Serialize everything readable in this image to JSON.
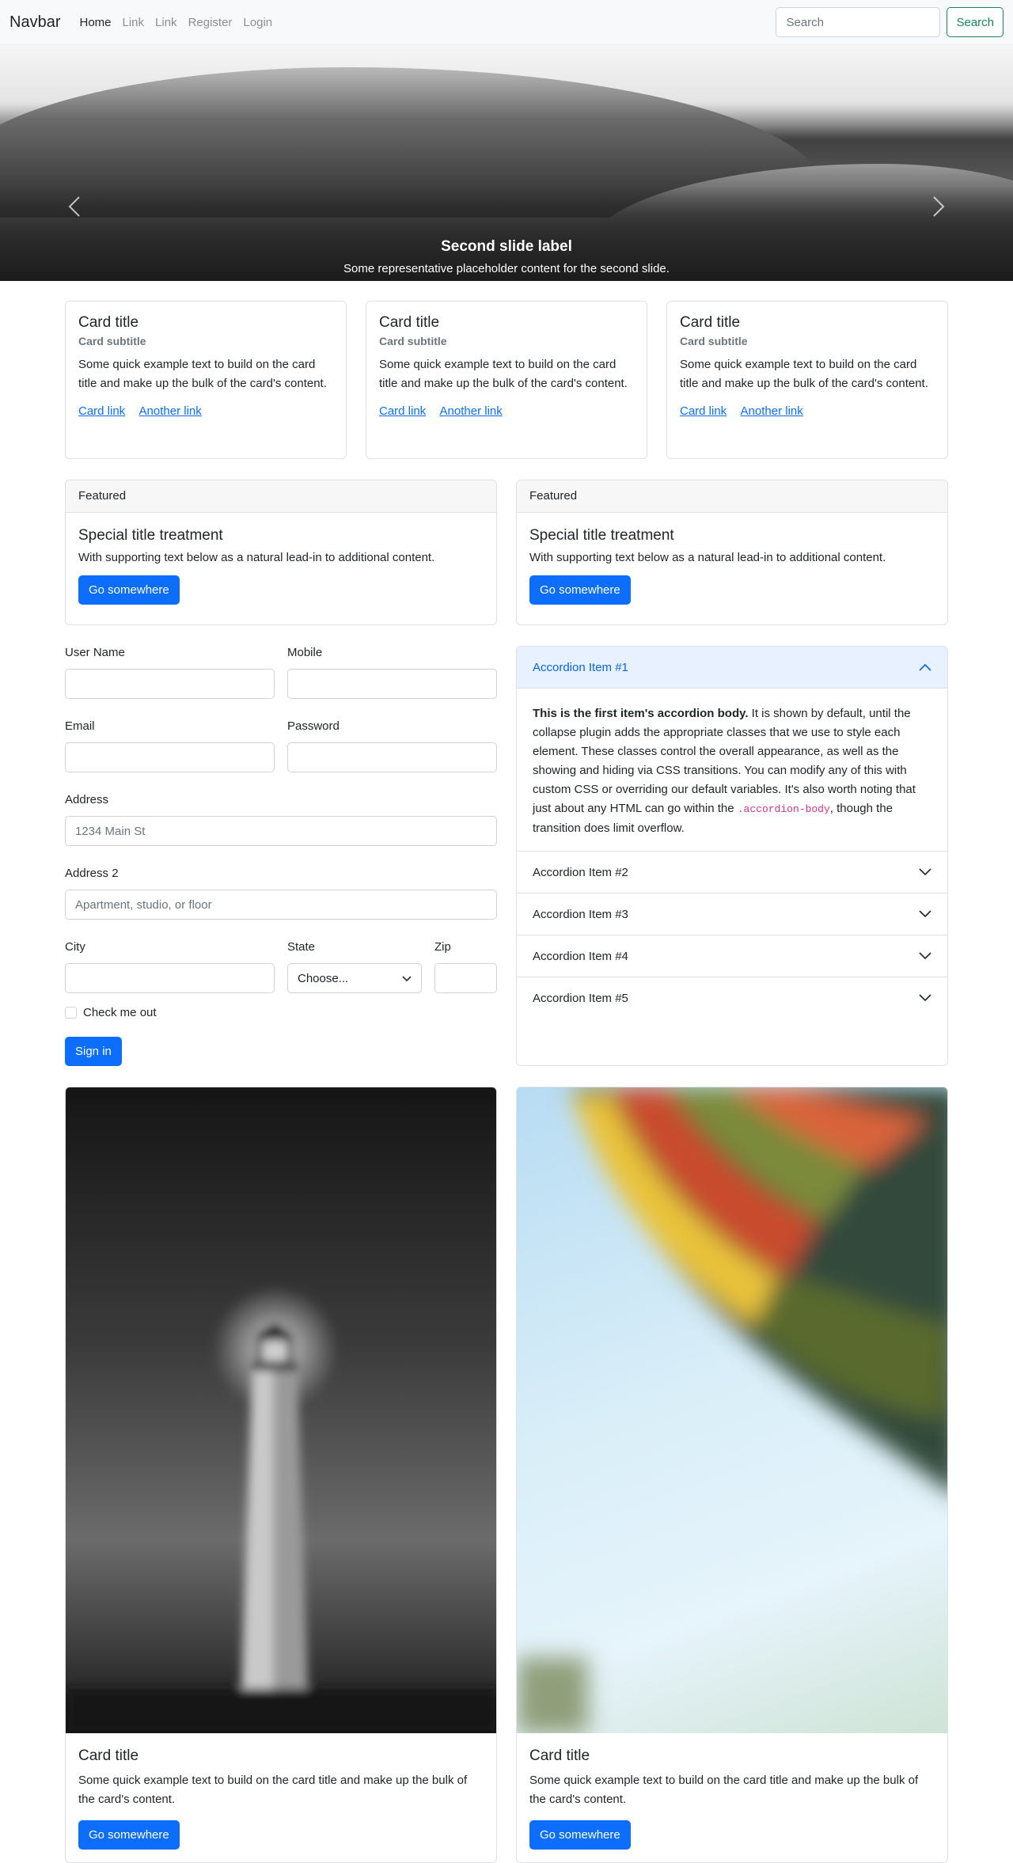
{
  "navbar": {
    "brand": "Navbar",
    "links": [
      "Home",
      "Link",
      "Link",
      "Register",
      "Login"
    ],
    "search_placeholder": "Search",
    "search_button": "Search"
  },
  "carousel": {
    "label": "Second slide label",
    "text": "Some representative placeholder content for the second slide.",
    "indicator_count": 3,
    "active_index": 1
  },
  "cards": [
    {
      "title": "Card title",
      "subtitle": "Card subtitle",
      "text": "Some quick example text to build on the card title and make up the bulk of the card's content.",
      "link1": "Card link",
      "link2": "Another link"
    },
    {
      "title": "Card title",
      "subtitle": "Card subtitle",
      "text": "Some quick example text to build on the card title and make up the bulk of the card's content.",
      "link1": "Card link",
      "link2": "Another link"
    },
    {
      "title": "Card title",
      "subtitle": "Card subtitle",
      "text": "Some quick example text to build on the card title and make up the bulk of the card's content.",
      "link1": "Card link",
      "link2": "Another link"
    }
  ],
  "featured": [
    {
      "header": "Featured",
      "title": "Special title treatment",
      "text": "With supporting text below as a natural lead-in to additional content.",
      "button": "Go somewhere"
    },
    {
      "header": "Featured",
      "title": "Special title treatment",
      "text": "With supporting text below as a natural lead-in to additional content.",
      "button": "Go somewhere"
    }
  ],
  "form": {
    "username_label": "User Name",
    "mobile_label": "Mobile",
    "email_label": "Email",
    "password_label": "Password",
    "address_label": "Address",
    "address_placeholder": "1234 Main St",
    "address2_label": "Address 2",
    "address2_placeholder": "Apartment, studio, or floor",
    "city_label": "City",
    "state_label": "State",
    "state_value": "Choose...",
    "zip_label": "Zip",
    "check_label": "Check me out",
    "submit": "Sign in"
  },
  "accordion": {
    "items": [
      "Accordion Item #1",
      "Accordion Item #2",
      "Accordion Item #3",
      "Accordion Item #4",
      "Accordion Item #5"
    ],
    "body_strong": "This is the first item's accordion body.",
    "body_text": " It is shown by default, until the collapse plugin adds the appropriate classes that we use to style each element. These classes control the overall appearance, as well as the showing and hiding via CSS transitions. You can modify any of this with custom CSS or overriding our default variables. It's also worth noting that just about any HTML can go within the ",
    "body_code": ".accordion-body",
    "body_end": ", though the transition does limit overflow."
  },
  "image_cards": [
    {
      "title": "Card title",
      "text": "Some quick example text to build on the card title and make up the bulk of the card's content.",
      "button": "Go somewhere"
    },
    {
      "title": "Card title",
      "text": "Some quick example text to build on the card title and make up the bulk of the card's content.",
      "button": "Go somewhere"
    }
  ]
}
